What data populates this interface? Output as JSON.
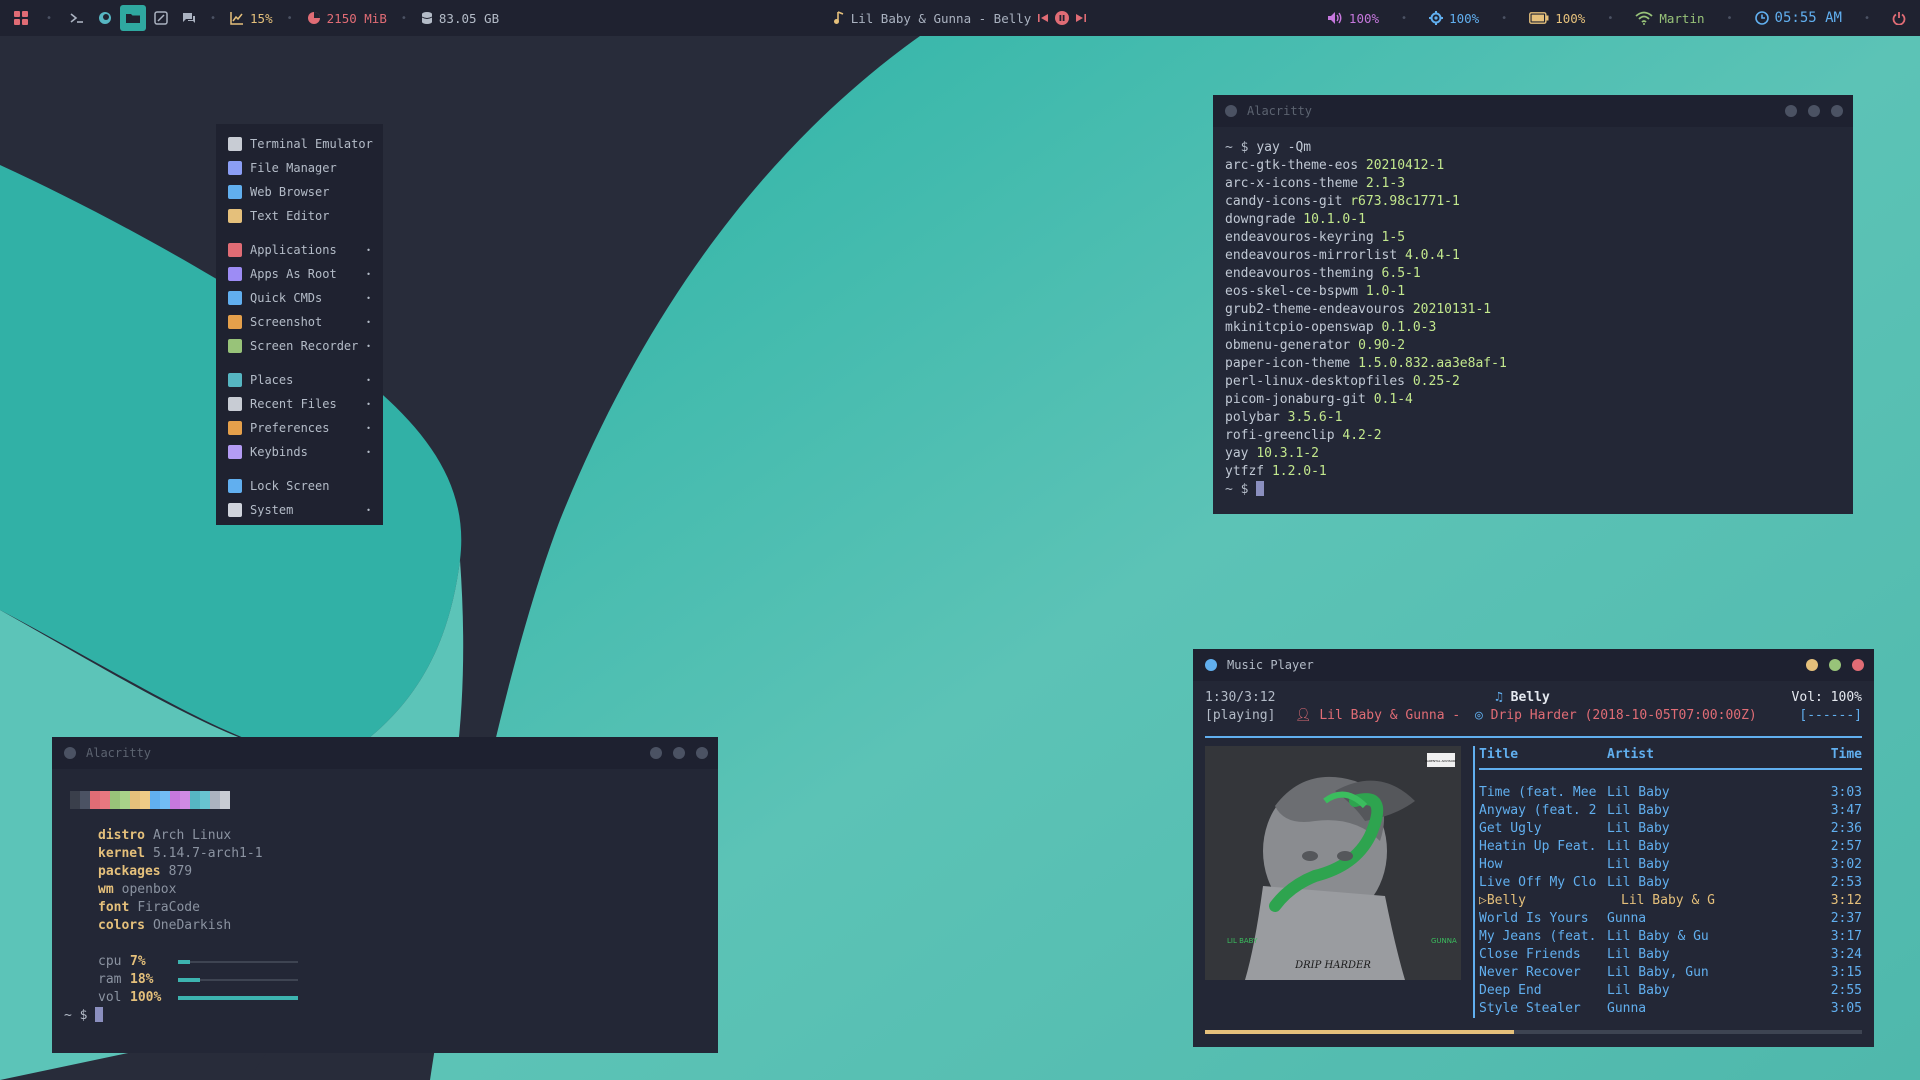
{
  "colors": {
    "accent_teal": "#2fa8a0",
    "bar_bg": "#1f2230",
    "window_bg": "#232736",
    "music_blue": "#61afef",
    "music_yellow": "#e5c07b",
    "music_red": "#e06c75",
    "green": "#c3e88d"
  },
  "topbar": {
    "launcher_icons": [
      "apps-grid-icon",
      "dot-icon",
      "terminal-icon",
      "browser-icon",
      "files-icon",
      "editor-icon",
      "chat-icon"
    ],
    "cpu": "15%",
    "ram": "2150 MiB",
    "disk": "83.05 GB",
    "now_playing": "Lil Baby & Gunna - Belly",
    "volume": "100%",
    "brightness": "100%",
    "battery": "100%",
    "wifi": "Martin",
    "time": "05:55 AM"
  },
  "menu": {
    "groups": [
      [
        {
          "label": "Terminal Emulator",
          "icon": "terminal-icon",
          "color": "#c8ccd4",
          "submenu": false
        },
        {
          "label": "File Manager",
          "icon": "folder-icon",
          "color": "#8b9ef5",
          "submenu": false
        },
        {
          "label": "Web Browser",
          "icon": "globe-icon",
          "color": "#61afef",
          "submenu": false
        },
        {
          "label": "Text Editor",
          "icon": "pencil-icon",
          "color": "#e5c07b",
          "submenu": false
        }
      ],
      [
        {
          "label": "Applications",
          "icon": "grid-icon",
          "color": "#e06c75",
          "submenu": true
        },
        {
          "label": "Apps As Root",
          "icon": "hexagon-icon",
          "color": "#9d8cf5",
          "submenu": true
        },
        {
          "label": "Quick CMDs",
          "icon": "wrench-icon",
          "color": "#61afef",
          "submenu": true
        },
        {
          "label": "Screenshot",
          "icon": "screenshot-icon",
          "color": "#e5a04b",
          "submenu": true
        },
        {
          "label": "Screen Recorder",
          "icon": "camera-icon",
          "color": "#98c379",
          "submenu": true
        }
      ],
      [
        {
          "label": "Places",
          "icon": "places-icon",
          "color": "#56b6c2",
          "submenu": true
        },
        {
          "label": "Recent Files",
          "icon": "recent-icon",
          "color": "#c8ccd4",
          "submenu": true
        },
        {
          "label": "Preferences",
          "icon": "gear-icon",
          "color": "#e5a04b",
          "submenu": true
        },
        {
          "label": "Keybinds",
          "icon": "keyboard-icon",
          "color": "#b49cf5",
          "submenu": true
        }
      ],
      [
        {
          "label": "Lock Screen",
          "icon": "lock-icon",
          "color": "#61afef",
          "submenu": false
        },
        {
          "label": "System",
          "icon": "power-icon",
          "color": "#d0d4dc",
          "submenu": true
        }
      ]
    ]
  },
  "term1": {
    "title": "Alacritty",
    "prompt": "~ $",
    "command": "yay -Qm",
    "packages": [
      {
        "name": "arc-gtk-theme-eos",
        "version": "20210412-1"
      },
      {
        "name": "arc-x-icons-theme",
        "version": "2.1-3"
      },
      {
        "name": "candy-icons-git",
        "version": "r673.98c1771-1"
      },
      {
        "name": "downgrade",
        "version": "10.1.0-1"
      },
      {
        "name": "endeavouros-keyring",
        "version": "1-5"
      },
      {
        "name": "endeavouros-mirrorlist",
        "version": "4.0.4-1"
      },
      {
        "name": "endeavouros-theming",
        "version": "6.5-1"
      },
      {
        "name": "eos-skel-ce-bspwm",
        "version": "1.0-1"
      },
      {
        "name": "grub2-theme-endeavouros",
        "version": "20210131-1"
      },
      {
        "name": "mkinitcpio-openswap",
        "version": "0.1.0-3"
      },
      {
        "name": "obmenu-generator",
        "version": "0.90-2"
      },
      {
        "name": "paper-icon-theme",
        "version": "1.5.0.832.aa3e8af-1"
      },
      {
        "name": "perl-linux-desktopfiles",
        "version": "0.25-2"
      },
      {
        "name": "picom-jonaburg-git",
        "version": "0.1-4"
      },
      {
        "name": "polybar",
        "version": "3.5.6-1"
      },
      {
        "name": "rofi-greenclip",
        "version": "4.2-2"
      },
      {
        "name": "yay",
        "version": "10.3.1-2"
      },
      {
        "name": "ytfzf",
        "version": "1.2.0-1"
      }
    ]
  },
  "term2": {
    "title": "Alacritty",
    "prompt": "~ $",
    "palette": [
      "#3a3f4b",
      "#4b5263",
      "#e06c75",
      "#e87880",
      "#98c379",
      "#a8d389",
      "#e5c07b",
      "#f0cb86",
      "#61afef",
      "#72bcf5",
      "#c678dd",
      "#d08ae4",
      "#56b6c2",
      "#68c4d0",
      "#abb2bf",
      "#c8ccd4"
    ],
    "fetch": [
      {
        "key": "distro",
        "value": "Arch Linux"
      },
      {
        "key": "kernel",
        "value": "5.14.7-arch1-1"
      },
      {
        "key": "packages",
        "value": "879"
      },
      {
        "key": "wm",
        "value": "openbox"
      },
      {
        "key": "font",
        "value": "FiraCode"
      },
      {
        "key": "colors",
        "value": "OneDarkish"
      }
    ],
    "stats": [
      {
        "key": "cpu",
        "value": "7%",
        "level": 0.07
      },
      {
        "key": "ram",
        "value": "18%",
        "level": 0.18
      },
      {
        "key": "vol",
        "value": "100%",
        "level": 1.0
      }
    ]
  },
  "music": {
    "title": "Music Player",
    "elapsed": "1:30/3:12",
    "progress": 0.47,
    "state": "[playing]",
    "song": "Belly",
    "artist": "Lil Baby & Gunna -",
    "album": "Drip Harder (2018-10-05T07:00:00Z)",
    "volume": "Vol: 100%",
    "flags": "[------]",
    "headers": {
      "title": "Title",
      "artist": "Artist",
      "time": "Time"
    },
    "album_art": {
      "badge": "PARENTAL ADVISORY",
      "left_text": "LIL BABY",
      "right_text": "GUNNA",
      "center_text": "DRIP HARDER"
    },
    "tracks": [
      {
        "title": "Time (feat. Mee",
        "artist": "Lil Baby",
        "time": "3:03",
        "current": false
      },
      {
        "title": "Anyway (feat. 2",
        "artist": "Lil Baby",
        "time": "3:47",
        "current": false
      },
      {
        "title": "Get Ugly",
        "artist": "Lil Baby",
        "time": "2:36",
        "current": false
      },
      {
        "title": "Heatin Up Feat.",
        "artist": "Lil Baby",
        "time": "2:57",
        "current": false
      },
      {
        "title": "How",
        "artist": "Lil Baby",
        "time": "3:02",
        "current": false
      },
      {
        "title": "Live Off My Clo",
        "artist": "Lil Baby",
        "time": "2:53",
        "current": false
      },
      {
        "title": "Belly",
        "artist": "Lil Baby & G",
        "time": "3:12",
        "current": true
      },
      {
        "title": "World Is Yours",
        "artist": "Gunna",
        "time": "2:37",
        "current": false
      },
      {
        "title": "My Jeans (feat.",
        "artist": "Lil Baby & Gu",
        "time": "3:17",
        "current": false
      },
      {
        "title": "Close Friends",
        "artist": "Lil Baby",
        "time": "3:24",
        "current": false
      },
      {
        "title": "Never Recover",
        "artist": "Lil Baby, Gun",
        "time": "3:15",
        "current": false
      },
      {
        "title": "Deep End",
        "artist": "Lil Baby",
        "time": "2:55",
        "current": false
      },
      {
        "title": "Style Stealer",
        "artist": "Gunna",
        "time": "3:05",
        "current": false
      }
    ]
  }
}
